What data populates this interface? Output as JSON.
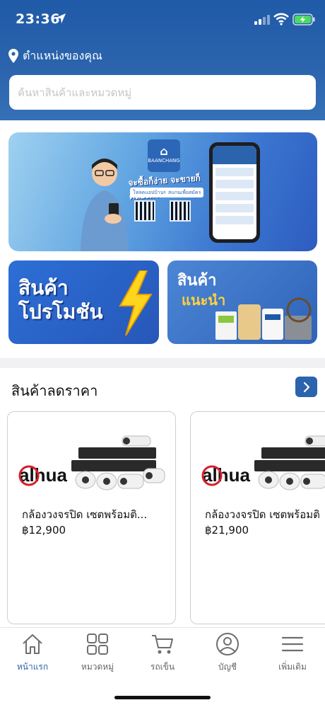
{
  "status_bar": {
    "time": "23:36"
  },
  "location": {
    "label": "ตำแหน่งของคุณ"
  },
  "search": {
    "placeholder": "ค้นหาสินค้าและหมวดหมู่"
  },
  "main_banner": {
    "logo_text": "BAANCHANG",
    "headline": "จะซื้อก็ง่าย จะขายก็คล่องตัว",
    "chip_left": "โหลดแอปบ้านช่าง",
    "chip_right": "สแกนเพื่อสมัคร"
  },
  "promo_banner": {
    "line1": "สินค้า",
    "line2": "โปรโมชัน"
  },
  "recommend_banner": {
    "line1": "สินค้า",
    "line2": "แนะนำ"
  },
  "discount_section": {
    "title": "สินค้าลดราคา",
    "products": [
      {
        "brand": "alhua",
        "name": "กล้องวงจรปิด เซตพร้อมติ...",
        "price": "฿12,900"
      },
      {
        "brand": "alhua",
        "name": "กล้องวงจรปิด เซตพร้อมติ",
        "price": "฿21,900"
      }
    ]
  },
  "bottom_nav": {
    "items": [
      {
        "label": "หน้าแรก",
        "icon": "home-icon",
        "active": true
      },
      {
        "label": "หมวดหมู่",
        "icon": "grid-icon",
        "active": false
      },
      {
        "label": "รถเข็น",
        "icon": "cart-icon",
        "active": false
      },
      {
        "label": "บัญชี",
        "icon": "user-icon",
        "active": false
      },
      {
        "label": "เพิ่มเติม",
        "icon": "menu-icon",
        "active": false
      }
    ]
  },
  "colors": {
    "brand_blue": "#2c63ad",
    "header_top": "#1f5aa8",
    "price_text": "#111111"
  }
}
